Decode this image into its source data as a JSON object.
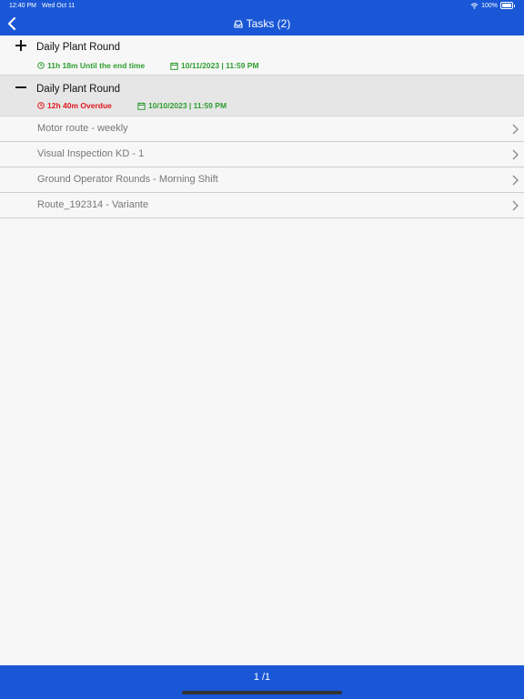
{
  "status_bar": {
    "time": "12:40 PM",
    "date": "Wed Oct 11",
    "battery": "100%"
  },
  "header": {
    "title": "Tasks (2)"
  },
  "groups": [
    {
      "name": "Daily Plant Round",
      "expanded": false,
      "time_text": "11h 18m Until the end time",
      "time_status": "ok",
      "date_text": "10/11/2023 | 11:59 PM"
    },
    {
      "name": "Daily Plant Round",
      "expanded": true,
      "time_text": "12h 40m Overdue",
      "time_status": "overdue",
      "date_text": "10/10/2023 | 11:59 PM"
    }
  ],
  "routes": [
    "Motor route - weekly",
    "Visual Inspection KD - 1",
    "Ground Operator Rounds - Morning Shift",
    "Route_192314 - Variante"
  ],
  "footer": {
    "pagination": "1 /1"
  },
  "colors": {
    "brand_blue": "#1957d6",
    "ok_green": "#2f9e31",
    "overdue_red": "#e0171c"
  }
}
